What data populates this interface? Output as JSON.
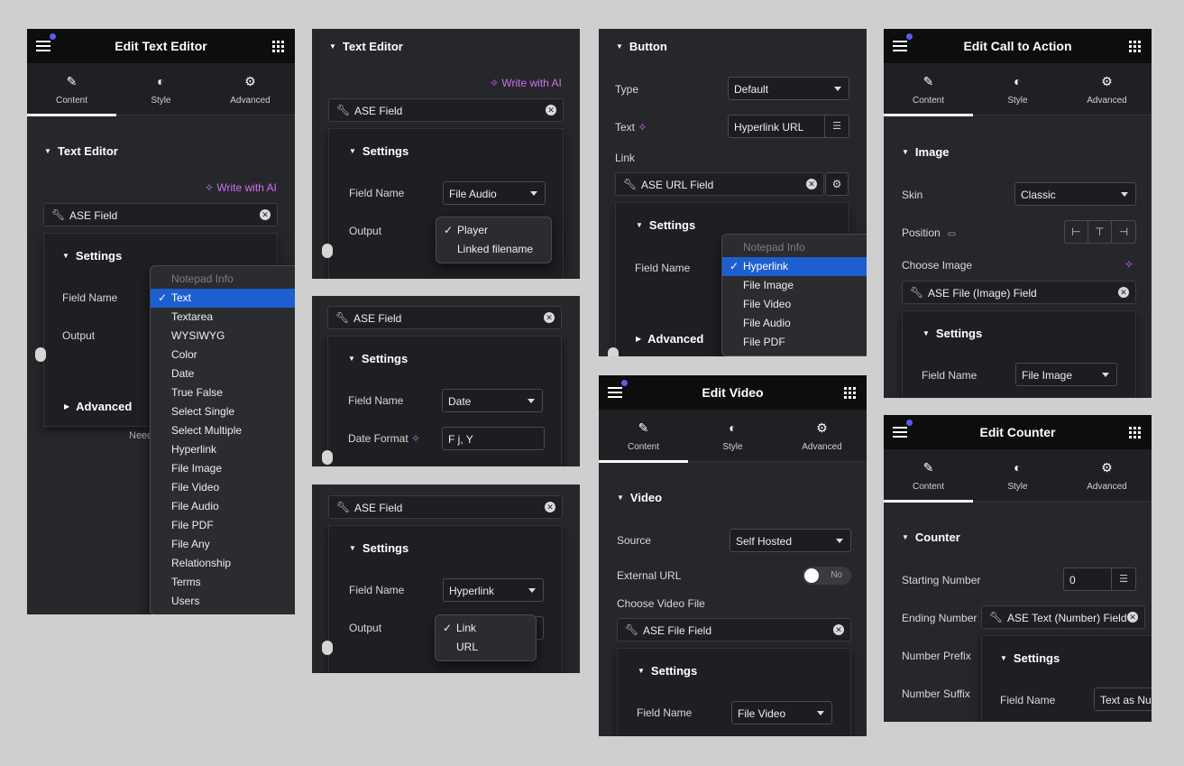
{
  "colors": {
    "accent_ai": "#d06ef0",
    "selected": "#1e5fd0",
    "notify_dot": "#5b5bf0"
  },
  "tabs": {
    "content": "Content",
    "style": "Style",
    "advanced": "Advanced"
  },
  "p1": {
    "title": "Edit Text Editor",
    "section": "Text Editor",
    "ai": "Write with AI",
    "field": "ASE Field",
    "settings": "Settings",
    "field_name_label": "Field Name",
    "output_label": "Output",
    "advanced": "Advanced",
    "footer_cut": "Need",
    "menu": {
      "header": "Notepad Info",
      "items": [
        "Text",
        "Textarea",
        "WYSIWYG",
        "Color",
        "Date",
        "True False",
        "Select Single",
        "Select Multiple",
        "Hyperlink",
        "File Image",
        "File Video",
        "File Audio",
        "File PDF",
        "File Any",
        "Relationship",
        "Terms",
        "Users"
      ],
      "selected": "Text"
    }
  },
  "p2": {
    "section": "Text Editor",
    "ai": "Write with AI",
    "field": "ASE Field",
    "settings": "Settings",
    "field_name_label": "Field Name",
    "field_name_value": "File Audio",
    "output_label": "Output",
    "menu": [
      "Player",
      "Linked filename"
    ],
    "selected": "Player"
  },
  "p3": {
    "field": "ASE Field",
    "settings": "Settings",
    "field_name_label": "Field Name",
    "field_name_value": "Date",
    "date_format_label": "Date Format",
    "date_format_value": "F j, Y"
  },
  "p4": {
    "field": "ASE Field",
    "settings": "Settings",
    "field_name_label": "Field Name",
    "field_name_value": "Hyperlink",
    "output_label": "Output",
    "menu": [
      "Link",
      "URL"
    ],
    "selected": "Link"
  },
  "p5": {
    "section": "Button",
    "type_label": "Type",
    "type_value": "Default",
    "text_label": "Text",
    "text_value": "Hyperlink URL",
    "link_label": "Link",
    "field": "ASE URL Field",
    "settings": "Settings",
    "field_name_label": "Field Name",
    "advanced": "Advanced",
    "menu": {
      "header": "Notepad Info",
      "items": [
        "Hyperlink",
        "File Image",
        "File Video",
        "File Audio",
        "File PDF"
      ],
      "selected": "Hyperlink"
    }
  },
  "p6": {
    "title": "Edit Video",
    "section": "Video",
    "source_label": "Source",
    "source_value": "Self Hosted",
    "external_label": "External URL",
    "toggle": "No",
    "choose_label": "Choose Video File",
    "field": "ASE File Field",
    "settings": "Settings",
    "field_name_label": "Field Name",
    "field_name_value": "File Video"
  },
  "p7": {
    "title": "Edit Call to Action",
    "section": "Image",
    "skin_label": "Skin",
    "skin_value": "Classic",
    "position_label": "Position",
    "choose_label": "Choose Image",
    "field": "ASE File (Image) Field",
    "settings": "Settings",
    "field_name_label": "Field Name",
    "field_name_value": "File Image"
  },
  "p8": {
    "title": "Edit Counter",
    "section": "Counter",
    "start_label": "Starting Number",
    "start_value": "0",
    "end_label": "Ending Number",
    "field": "ASE Text (Number) Field",
    "prefix_label": "Number Prefix",
    "suffix_label": "Number Suffix",
    "settings": "Settings",
    "field_name_label": "Field Name",
    "field_name_value": "Text as Nu"
  }
}
